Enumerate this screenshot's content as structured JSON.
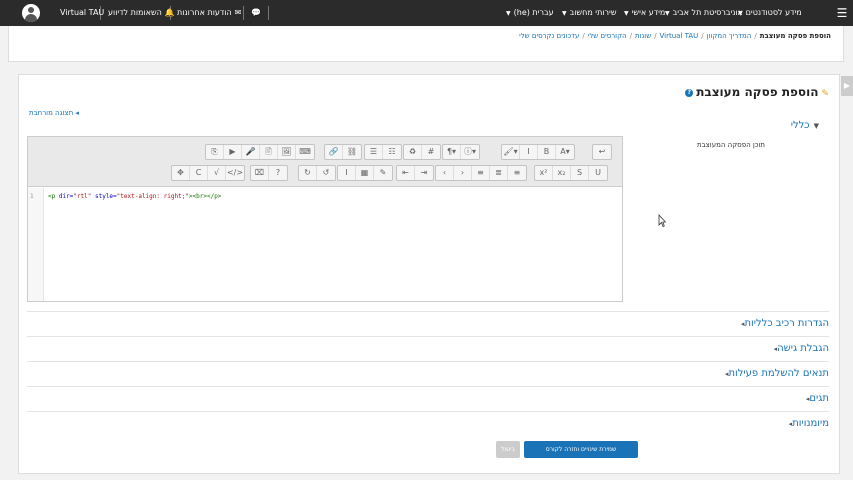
{
  "navbar": {
    "menus": [
      {
        "label": "מידע לסטודנטים"
      },
      {
        "label": "אוניברסיטת תל אביב"
      },
      {
        "label": "מידע אישי"
      },
      {
        "label": "שירותי מחשוב"
      },
      {
        "label": "עברית (he)"
      }
    ],
    "messages_label": "הודעות אחרונות",
    "notifications_label": "השאומות לדיווע",
    "user_name": "Virtual TAU"
  },
  "breadcrumb": {
    "items": [
      "עדכונים נקרסים שלי",
      "הקורסים שלי",
      "שונות",
      "Virtual TAU",
      "המדריך המקוון"
    ],
    "current": "הוספת פסקה מעוצבת"
  },
  "page": {
    "title": "הוספת פסקה מעוצבת",
    "expand_all": "תצוגה מורחבת",
    "general_section": "כללי",
    "content_label": "תוכן הפסקה המעוצבת"
  },
  "editor": {
    "line_number": "1",
    "code": {
      "open_tag": "<p",
      "attr1": " dir=",
      "val1": "\"rtl\"",
      "attr2": " style=",
      "val2": "\"text-align: right;\"",
      "rest": "><br></p>"
    },
    "toolbar_row1": [
      [
        "⎘",
        "▶",
        "🎤",
        "🖹",
        "🖼",
        "⌨"
      ],
      [
        "🔗",
        "⛓"
      ],
      [
        "☰",
        "☷"
      ],
      [
        "♻",
        "#"
      ],
      [
        "¶▾",
        "ⓘ▾"
      ],
      [
        "🖌▾",
        "I",
        "B",
        "A▾"
      ],
      [
        "↩"
      ]
    ],
    "toolbar_row2": [
      [
        "✥",
        "C",
        "√",
        "</>"
      ],
      [
        "⌧",
        "?"
      ],
      [
        "↻",
        "↺"
      ],
      [
        "I",
        "▦",
        "✎"
      ],
      [
        "⇤",
        "⇥"
      ],
      [
        "‹",
        "›",
        "≡",
        "≣",
        "≡"
      ],
      [
        "x²",
        "x₂",
        "S",
        "U"
      ]
    ]
  },
  "sections": [
    {
      "label": "הגדרות רכיב כלליות"
    },
    {
      "label": "הגבלת גישה"
    },
    {
      "label": "תנאים להשלמת פעילות"
    },
    {
      "label": "תגים"
    },
    {
      "label": "מיומנויות"
    }
  ],
  "buttons": {
    "save_return": "שמירת שינויים וחזרה לקורס",
    "cancel": "ביטול"
  },
  "colors": {
    "navbar": "#2b2b2b",
    "link": "#1a73b6",
    "primary_button": "#1a73b6"
  }
}
